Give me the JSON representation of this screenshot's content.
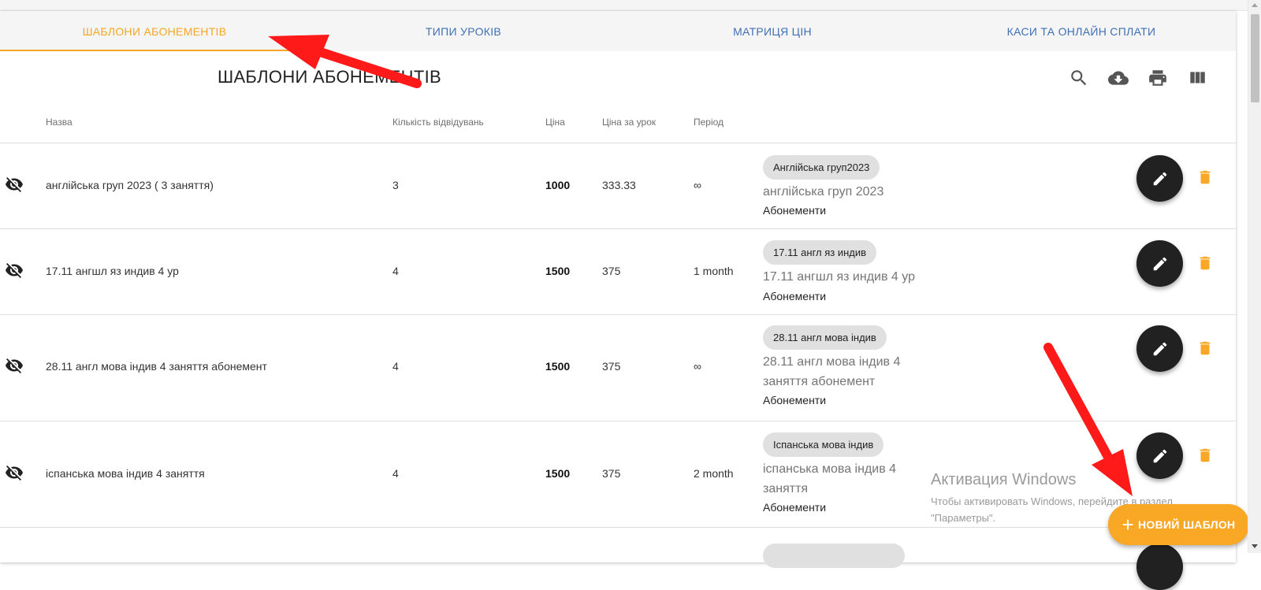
{
  "tabs": [
    {
      "label": "ШАБЛОНИ АБОНЕМЕНТІВ",
      "active": true
    },
    {
      "label": "ТИПИ УРОКІВ",
      "active": false
    },
    {
      "label": "МАТРИЦЯ ЦІН",
      "active": false
    },
    {
      "label": "КАСИ ТА ОНЛАЙН СПЛАТИ",
      "active": false
    }
  ],
  "page_title": "ШАБЛОНИ АБОНЕМЕНТІВ",
  "toolbar_icons": [
    "search-icon",
    "cloud-download-icon",
    "print-icon",
    "view-column-icon"
  ],
  "columns": {
    "name": "Назва",
    "visits": "Кількість відвідувань",
    "price": "Ціна",
    "price_per_lesson": "Ціна за урок",
    "period": "Період"
  },
  "rows": [
    {
      "name": "англійська груп 2023 ( 3 заняття)",
      "visits": "3",
      "price": "1000",
      "price_per_lesson": "333.33",
      "period": "∞",
      "chip": "Англійська груп2023",
      "sub_title": "англійська груп 2023",
      "sub_category": "Абонементи"
    },
    {
      "name": "17.11 ангшл яз индив 4 ур",
      "visits": "4",
      "price": "1500",
      "price_per_lesson": "375",
      "period": "1 month",
      "chip": "17.11 англ яз индив",
      "sub_title": "17.11 ангшл яз индив 4 ур",
      "sub_category": "Абонементи"
    },
    {
      "name": "28.11 англ мова індив 4 заняття абонемент",
      "visits": "4",
      "price": "1500",
      "price_per_lesson": "375",
      "period": "∞",
      "chip": "28.11 англ мова індив",
      "sub_title": "28.11 англ мова індив 4 заняття абонемент",
      "sub_category": "Абонементи"
    },
    {
      "name": "іспанська мова індив 4 заняття",
      "visits": "4",
      "price": "1500",
      "price_per_lesson": "375",
      "period": "2 month",
      "chip": "Іспанська мова індив",
      "sub_title": "іспанська мова індив 4 заняття",
      "sub_category": "Абонементи"
    }
  ],
  "watermark": {
    "title": "Активация Windows",
    "line1": "Чтобы активировать Windows, перейдите в раздел",
    "line2": "\"Параметры\"."
  },
  "new_template_button": "НОВИЙ ШАБЛОН",
  "colors": {
    "accent": "#f5a623",
    "tab_text": "#3f6fb5",
    "fab": "#212121",
    "trash": "#f9a825",
    "annotation_arrow": "#ff0000"
  }
}
